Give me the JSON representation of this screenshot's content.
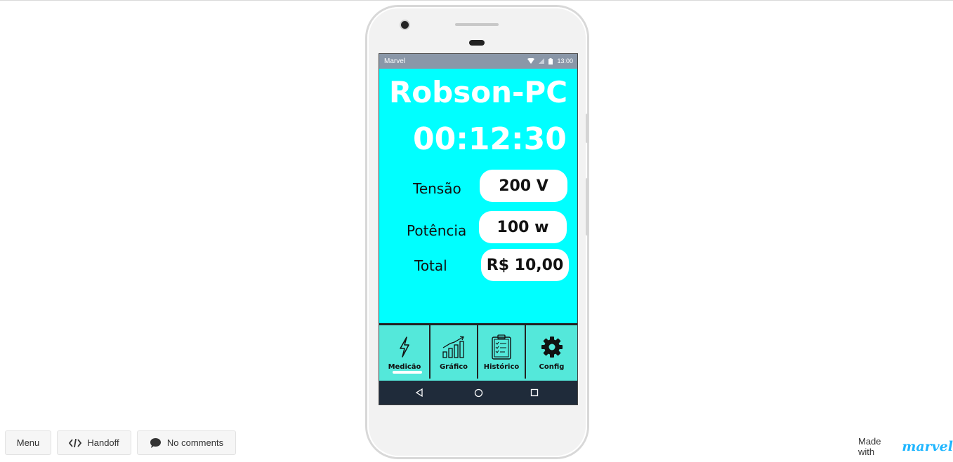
{
  "statusbar": {
    "carrier": "Marvel",
    "time": "13:00",
    "icons": [
      "wifi-icon",
      "signal-icon",
      "battery-icon"
    ]
  },
  "device": {
    "name": "Robson-PC",
    "timer": "00:12:30"
  },
  "readings": [
    {
      "label": "Tensão",
      "value": "200 V"
    },
    {
      "label": "Potência",
      "value": "100 w"
    },
    {
      "label": "Total",
      "value": "R$ 10,00"
    }
  ],
  "tabs": [
    {
      "label": "Medicão",
      "icon": "lightning-icon",
      "active": true
    },
    {
      "label": "Gráfico",
      "icon": "bar-chart-icon",
      "active": false
    },
    {
      "label": "Histórico",
      "icon": "clipboard-icon",
      "active": false
    },
    {
      "label": "Config",
      "icon": "gear-icon",
      "active": false
    }
  ],
  "navbar": {
    "icons": [
      "back-icon",
      "home-icon",
      "recents-icon"
    ]
  },
  "footer": {
    "menu_label": "Menu",
    "handoff_label": "Handoff",
    "comments_label": "No comments",
    "made_with": "Made with",
    "brand": "marvel"
  },
  "colors": {
    "screen_bg": "#00ffff",
    "tabbar_bg": "#54e8da",
    "navbar_bg": "#1f2b3a",
    "statusbar_bg": "#8a97a8",
    "brand": "#1fb6ff"
  }
}
